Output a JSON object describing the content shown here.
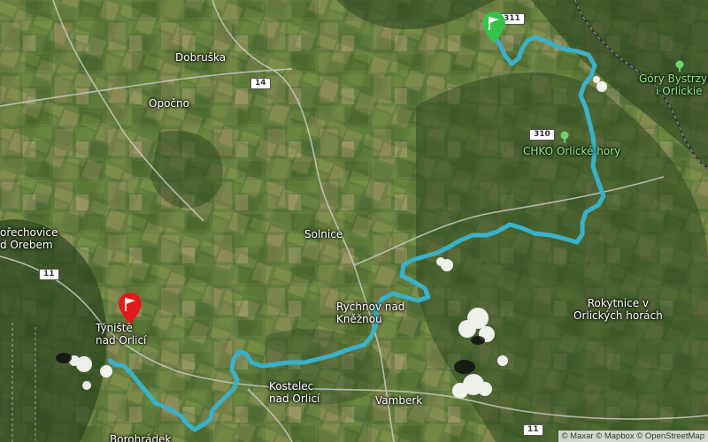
{
  "map": {
    "places": {
      "dobruska": "Dobruška",
      "opocno": "Opočno",
      "solnice": "Solnice",
      "rychnov": "Rychnov nad\nKněžnou",
      "kostelec": "Kostelec\nnad Orlicí",
      "vamberk": "Vamberk",
      "tyniste": "Týniště\nnad Orlicí",
      "rokytnice": "Rokytnice v\nOrlických horách",
      "pechovice": "ořechovice\nd Orebem",
      "borohradek": "Borohrádek",
      "gory": "Góry Bystrzyck\ni Orlickie"
    },
    "parks": {
      "chko": "CHKO Orlické hory"
    },
    "road_shields": {
      "r311": "311",
      "r14": "14",
      "r310": "310",
      "r11_west": "11",
      "r11_south": "11"
    },
    "markers": {
      "start_icon": "green-flag-pin",
      "end_icon": "red-flag-pin",
      "start_color": "#36c24a",
      "end_color": "#e01b1b"
    },
    "route_color": "#39b1c9",
    "attribution": "© Maxar © Mapbox © OpenStreetMap"
  }
}
